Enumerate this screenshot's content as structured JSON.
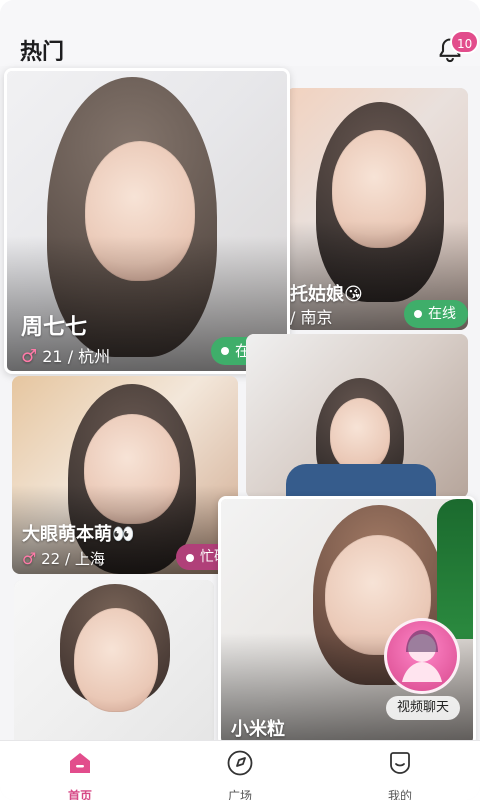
{
  "header": {
    "title": "热门",
    "notification_count": "10"
  },
  "cards": [
    {
      "name": "周七七",
      "age": "21",
      "city": "杭州",
      "status": "在线",
      "gender_icon": "male-symbol"
    },
    {
      "name": "托姑娘😘",
      "city": "南京",
      "status": "在线"
    },
    {
      "name": "大眼萌本萌👀",
      "age": "22",
      "city": "上海",
      "status": "忙碌",
      "gender_icon": "male-symbol"
    },
    {
      "name": "小米粒"
    }
  ],
  "video_chat": {
    "label": "视频聊天"
  },
  "tabs": [
    {
      "label": "首页",
      "icon": "home-icon",
      "active": true
    },
    {
      "label": "广场",
      "icon": "compass-icon",
      "active": false
    },
    {
      "label": "我的",
      "icon": "profile-icon",
      "active": false
    }
  ],
  "colors": {
    "accent": "#d64986",
    "online": "#3fae6a",
    "busy": "#b04079"
  }
}
